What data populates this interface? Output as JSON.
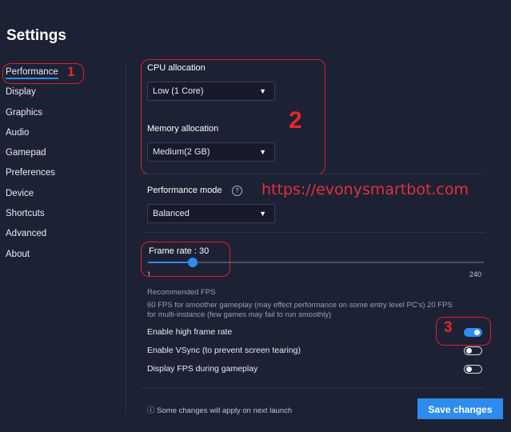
{
  "page": {
    "title": "Settings"
  },
  "sidebar": {
    "items": [
      {
        "label": "Performance"
      },
      {
        "label": "Display"
      },
      {
        "label": "Graphics"
      },
      {
        "label": "Audio"
      },
      {
        "label": "Gamepad"
      },
      {
        "label": "Preferences"
      },
      {
        "label": "Device"
      },
      {
        "label": "Shortcuts"
      },
      {
        "label": "Advanced"
      },
      {
        "label": "About"
      }
    ]
  },
  "cpu": {
    "label": "CPU allocation",
    "value": "Low (1 Core)"
  },
  "memory": {
    "label": "Memory allocation",
    "value": "Medium(2 GB)"
  },
  "perf_mode": {
    "label": "Performance mode",
    "value": "Balanced"
  },
  "frame_rate": {
    "label": "Frame rate : 30",
    "value": 30,
    "min": 1,
    "max": 240,
    "min_label": "1",
    "max_label": "240"
  },
  "recommended": {
    "title": "Recommended FPS",
    "line1": "60 FPS for smoother gameplay (may effect performance on some entry level PC's) 20 FPS",
    "line2": "for multi-instance (few games may fail to run smoothly)"
  },
  "toggles": [
    {
      "label": "Enable high frame rate",
      "on": true
    },
    {
      "label": "Enable VSync (to prevent screen tearing)",
      "on": false
    },
    {
      "label": "Display FPS during gameplay",
      "on": false
    }
  ],
  "footer": {
    "note": "Some changes will apply on next launch",
    "save_label": "Save changes"
  },
  "annotations": {
    "n1": "1",
    "n2": "2",
    "n3": "3",
    "watermark": "https://evonysmartbot.com"
  },
  "icons": {
    "caret": "caret-down-icon",
    "help": "help-circle-icon",
    "info": "info-circle-icon"
  },
  "colors": {
    "background": "#1d2134",
    "accent": "#2d8cf0",
    "annotation": "#e22a2a"
  }
}
